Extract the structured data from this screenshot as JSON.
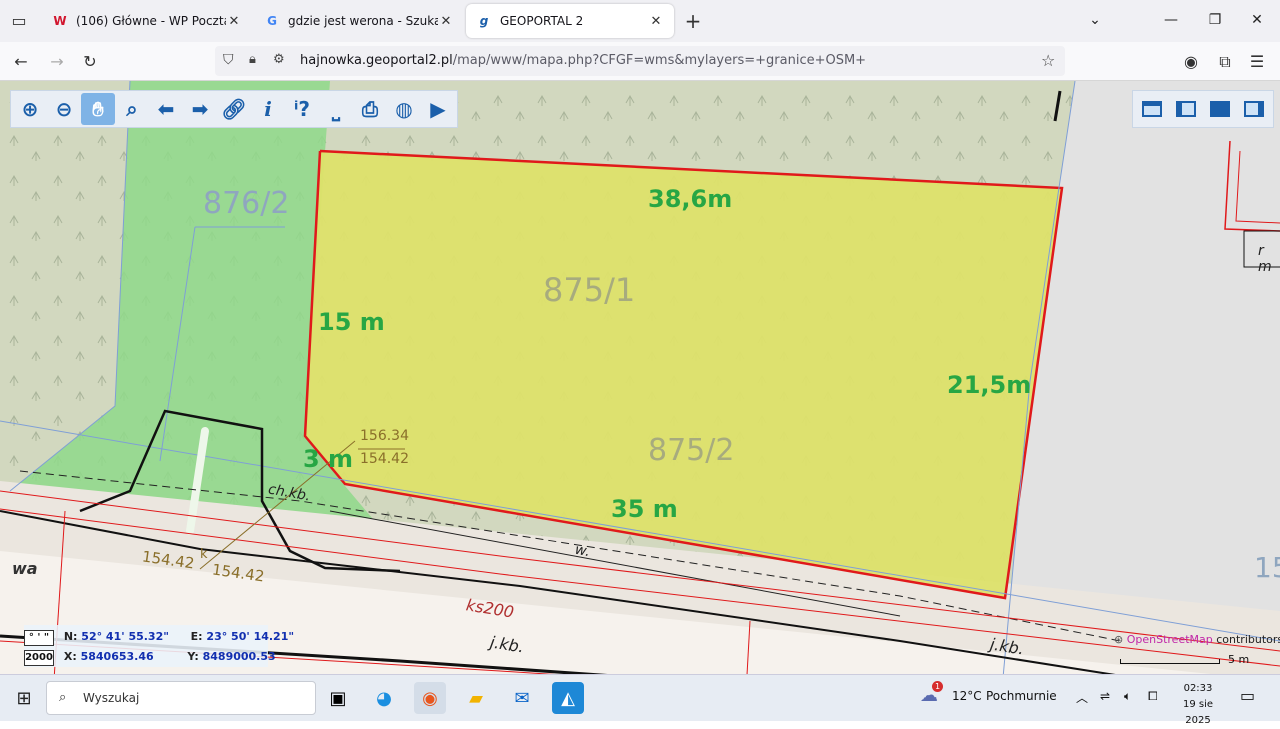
{
  "browser": {
    "tabs": [
      {
        "label": "(106) Główne - WP Poczta",
        "favicon": "wp-icon",
        "active": false
      },
      {
        "label": "gdzie jest werona - Szukaj w Go",
        "favicon": "google-icon",
        "active": false
      },
      {
        "label": "GEOPORTAL 2",
        "favicon": "geoportal-icon",
        "active": true
      }
    ],
    "url_domain": "hajnowka.geoportal2.pl",
    "url_rest": "/map/www/mapa.php?CFGF=wms&mylayers=+granice+OSM+"
  },
  "map": {
    "parcels": [
      "876/2",
      "875/1",
      "875/2"
    ],
    "dimensions": {
      "top": "38,6m",
      "left": "15 m",
      "right": "21,5m",
      "bottom": "35 m",
      "corner": "3 m"
    },
    "height_top": "156.34",
    "height_bottom": "154.42",
    "road_heights": [
      "154.42",
      "154.42"
    ],
    "labels": {
      "chkb": "ch.kb.",
      "w": "w.",
      "ks": "ks200",
      "jkb1": "j.kb.",
      "jkb2": "j.kb.",
      "k": "k",
      "street": "wa",
      "right_num": "15",
      "right_code": "r m"
    },
    "coords": {
      "badge1": "° ' \"",
      "badge2": "2000",
      "n_label": "N:",
      "n_value": "52° 41' 55.32\"",
      "e_label": "E:",
      "e_value": "23° 50' 14.21\"",
      "x_label": "X:",
      "x_value": "5840653.46",
      "y_label": "Y:",
      "y_value": "8489000.53"
    },
    "attribution_link": "OpenStreetMap",
    "attribution_text": " contributors",
    "scale_label": "5 m"
  },
  "taskbar": {
    "search_text": "Wyszukaj",
    "weather_temp": "12°C",
    "weather_desc": "Pochmurnie",
    "time": "02:33",
    "date": "19 sie 2025",
    "notification_count": "1"
  },
  "colors": {
    "parcel_fill": "#dde26a",
    "parcel_border": "#e0191b",
    "green_area": "#8fd98a",
    "dimension_text": "#27a644"
  }
}
